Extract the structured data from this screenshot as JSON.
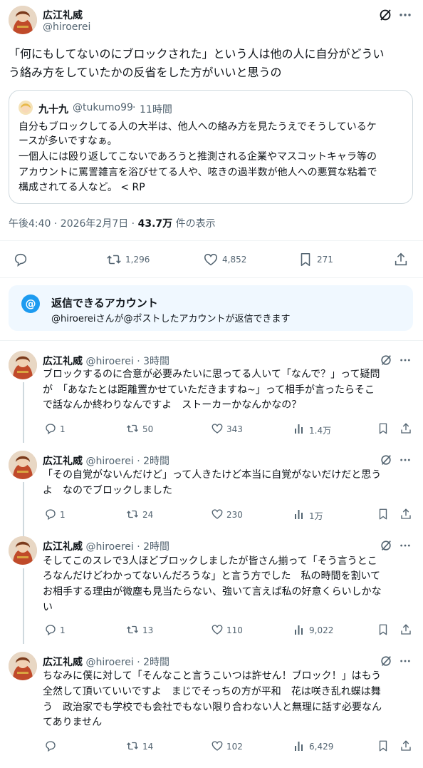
{
  "main": {
    "author_name": "広江礼威",
    "author_handle": "@hiroerei",
    "text_line1": "「何にもしてないのにブロックされた」という人は他の人に自分がどうい",
    "text_line2": "う絡み方をしていたかの反省をした方がいいと思うの",
    "quote": {
      "author_name": "九十九",
      "author_handle": "@tukumo99",
      "separator": "·",
      "time": "11時間",
      "lines": [
        "自分もブロックしてる人の大半は、他人への絡み方を見たうえでそうしているケ",
        "ースが多いですなぁ。",
        "一個人には殴り返してこないであろうと推測される企業やマスコットキャラ等の",
        "アカウントに罵詈雑言を浴びせてる人や、呟きの過半数が他人への悪質な粘着で",
        "構成されてる人など。 < RP"
      ]
    },
    "timestamp": "午後4:40 · 2026年2月7日 · ",
    "views_count": "43.7万",
    "views_label": " 件の表示",
    "stats": {
      "retweets": "1,296",
      "likes": "4,852",
      "bookmarks": "271"
    }
  },
  "reply_banner": {
    "title": "返信できるアカウント",
    "subtitle": "@hiroereiさんが@ポストしたアカウントが返信できます"
  },
  "replies": [
    {
      "author_name": "広江礼威",
      "author_handle": "@hiroerei",
      "time": "· 3時間",
      "lines": [
        "ブロックするのに合意が必要みたいに思ってる人いて「なんで？」って疑問",
        "が　「あなたとは距離置かせていただきますね~」って相手が言ったらそこ",
        "で話なんか終わりなんですよ　ストーカーかなんかなの？"
      ],
      "replies": "1",
      "retweets": "50",
      "likes": "343",
      "views": "1.4万"
    },
    {
      "author_name": "広江礼威",
      "author_handle": "@hiroerei",
      "time": "· 2時間",
      "lines": [
        "「その自覚がないんだけど」って人きたけど本当に自覚がないだけだと思う",
        "よ　なのでブロックしました"
      ],
      "replies": "1",
      "retweets": "24",
      "likes": "230",
      "views": "1万"
    },
    {
      "author_name": "広江礼威",
      "author_handle": "@hiroerei",
      "time": "· 2時間",
      "lines": [
        "そしてこのスレで3人ほどブロックしましたが皆さん揃って「そう言うとこ",
        "ろなんだけどわかってないんだろうな」と言う方でした　私の時間を割いて",
        "お相手する理由が微塵も見当たらない、強いて言えば私の好意くらいしかな",
        "い"
      ],
      "replies": "1",
      "retweets": "13",
      "likes": "110",
      "views": "9,022"
    },
    {
      "author_name": "広江礼威",
      "author_handle": "@hiroerei",
      "time": "· 2時間",
      "lines": [
        "ちなみに僕に対して「そんなこと言うこいつは許せん！ブロック！」はもう",
        "全然して頂いていいですよ　まじでそっちの方が平和　花は咲き乱れ蝶は舞",
        "う　政治家でも学校でも会社でもない限り合わない人と無理に話す必要なん",
        "てありません"
      ],
      "replies": "",
      "retweets": "14",
      "likes": "102",
      "views": "6,429"
    }
  ],
  "colors": {
    "accent": "#1d9bf0",
    "text": "#0f1419",
    "secondary": "#536471",
    "border": "#cfd9de"
  }
}
